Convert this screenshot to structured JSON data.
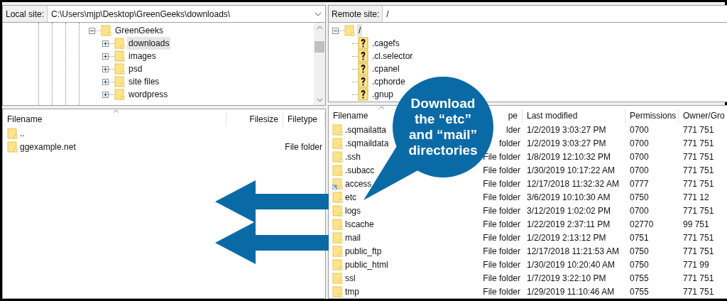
{
  "local_site": {
    "label": "Local site:",
    "path": "C:\\Users\\mjp\\Desktop\\GreenGeeks\\downloads\\"
  },
  "local_tree": [
    {
      "name": "GreenGeeks",
      "kind": "folder",
      "expanded": true,
      "selected": false,
      "children": [
        {
          "name": "downloads",
          "kind": "folder",
          "expanded": false,
          "selected": true
        },
        {
          "name": "images",
          "kind": "folder",
          "expanded": false,
          "selected": false
        },
        {
          "name": "psd",
          "kind": "folder",
          "expanded": false,
          "selected": false
        },
        {
          "name": "site files",
          "kind": "folder",
          "expanded": false,
          "selected": false
        },
        {
          "name": "wordpress",
          "kind": "folder",
          "expanded": false,
          "selected": false
        }
      ]
    }
  ],
  "local_list": {
    "columns": [
      "Filename",
      "Filesize",
      "Filetype"
    ],
    "rows": [
      {
        "name": ".."
      },
      {
        "name": "ggexample.net",
        "type": "File folder"
      }
    ]
  },
  "remote_site": {
    "label": "Remote site:",
    "path": "/"
  },
  "remote_tree": [
    {
      "name": "/",
      "kind": "folder",
      "expanded": true,
      "selected": true,
      "children": [
        {
          "name": ".cagefs",
          "kind": "unknown",
          "selected": false
        },
        {
          "name": ".cl.selector",
          "kind": "unknown",
          "selected": false
        },
        {
          "name": ".cpanel",
          "kind": "unknown",
          "selected": false
        },
        {
          "name": ".cphorde",
          "kind": "unknown",
          "selected": false
        },
        {
          "name": ".gnup",
          "kind": "unknown",
          "selected": false
        }
      ]
    }
  ],
  "remote_list": {
    "columns": [
      "Filename",
      "pe",
      "Last modified",
      "Permissions",
      "Owner/Gro"
    ],
    "rows": [
      {
        "name": ".sqmailatta",
        "link": false,
        "type": "lder",
        "modified": "1/2/2019 3:03:27 PM",
        "permissions": "0700",
        "owner": "771 751"
      },
      {
        "name": ".sqmaildata",
        "link": false,
        "type": "folder",
        "modified": "1/2/2019 3:03:27 PM",
        "permissions": "0700",
        "owner": "771 751"
      },
      {
        "name": ".ssh",
        "link": false,
        "type": "File folder",
        "modified": "1/8/2019 12:10:32 PM",
        "permissions": "0700",
        "owner": "771 751"
      },
      {
        "name": ".subacc",
        "link": false,
        "type": "File folder",
        "modified": "1/30/2019 10:17:22 AM",
        "permissions": "0700",
        "owner": "771 751"
      },
      {
        "name": "access",
        "link": true,
        "type": "File folder",
        "modified": "12/17/2018 11:32:32 AM",
        "permissions": "0777",
        "owner": "771 751"
      },
      {
        "name": "etc",
        "link": false,
        "type": "File folder",
        "modified": "3/6/2019 10:10:30 AM",
        "permissions": "0750",
        "owner": "771 12"
      },
      {
        "name": "logs",
        "link": false,
        "type": "File folder",
        "modified": "3/12/2019 1:02:02 PM",
        "permissions": "0700",
        "owner": "771 751"
      },
      {
        "name": "lscache",
        "link": false,
        "type": "File folder",
        "modified": "1/22/2019 2:37:11 PM",
        "permissions": "02770",
        "owner": "99 751"
      },
      {
        "name": "mail",
        "link": false,
        "type": "File folder",
        "modified": "1/2/2019 2:13:12 PM",
        "permissions": "0751",
        "owner": "771 751"
      },
      {
        "name": "public_ftp",
        "link": false,
        "type": "File folder",
        "modified": "12/17/2018 11:21:53 AM",
        "permissions": "0750",
        "owner": "771 751"
      },
      {
        "name": "public_html",
        "link": false,
        "type": "File folder",
        "modified": "1/30/2019 10:20:40 AM",
        "permissions": "0750",
        "owner": "771 99"
      },
      {
        "name": "ssl",
        "link": false,
        "type": "File folder",
        "modified": "1/7/2019 3:22:10 PM",
        "permissions": "0755",
        "owner": "771 751"
      },
      {
        "name": "tmp",
        "link": false,
        "type": "File folder",
        "modified": "1/29/2019 11:10:46 AM",
        "permissions": "0755",
        "owner": "771 751"
      }
    ]
  },
  "callout": {
    "lines": [
      "Download",
      "the “etc”",
      "and “mail”",
      "directories"
    ]
  }
}
